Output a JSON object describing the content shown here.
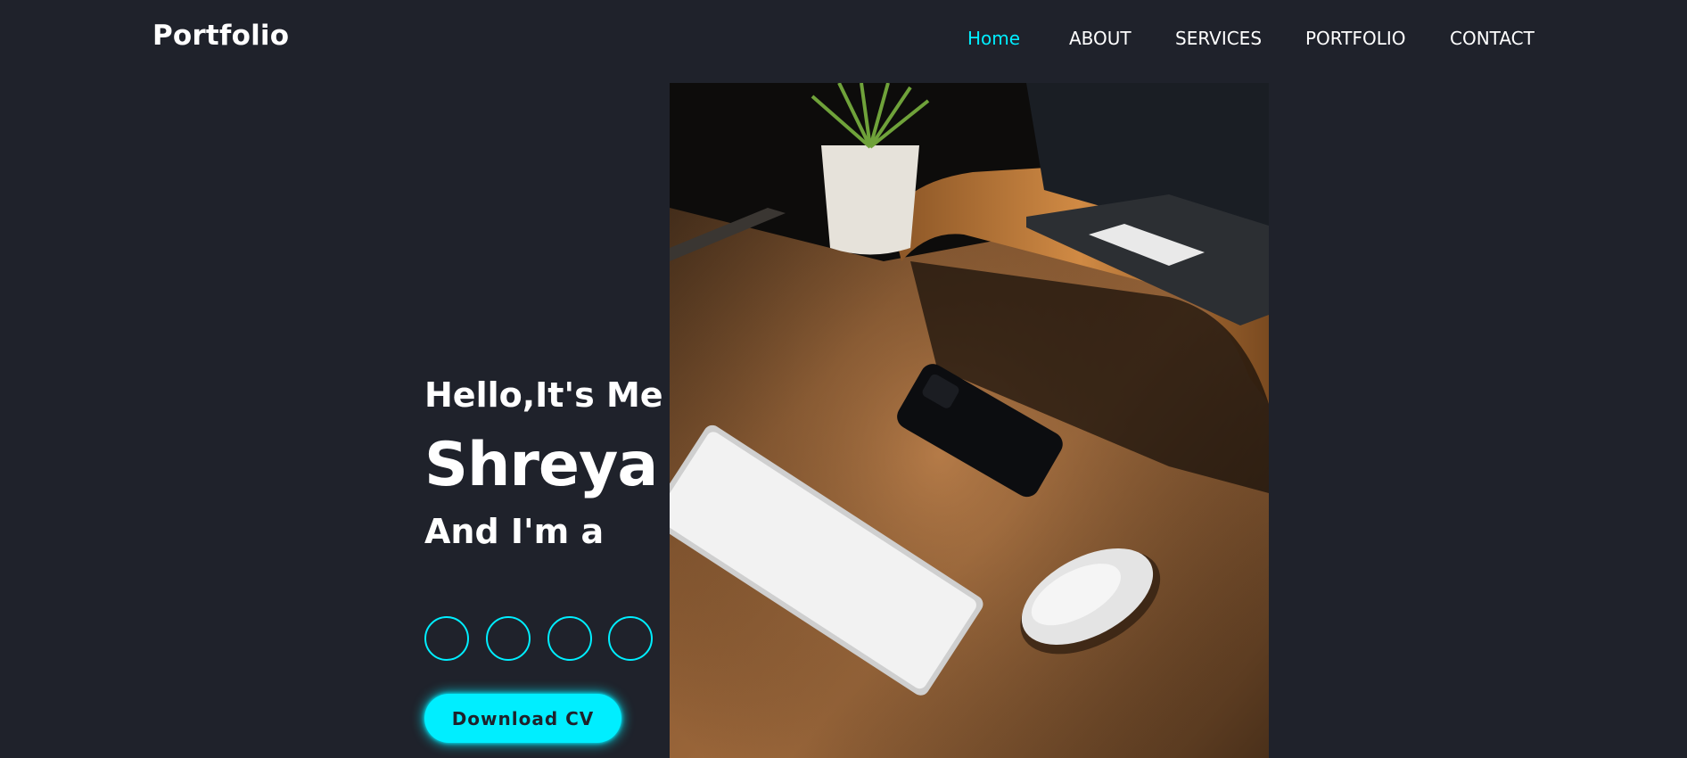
{
  "header": {
    "logo": "Portfolio",
    "nav": [
      {
        "label": "Home",
        "active": true
      },
      {
        "label": "ABOUT",
        "active": false
      },
      {
        "label": "SERVICES",
        "active": false
      },
      {
        "label": "PORTFOLIO",
        "active": false
      },
      {
        "label": "CONTACT",
        "active": false
      }
    ]
  },
  "hero": {
    "greeting": "Hello,It's Me",
    "name": "Shreya",
    "role_prefix": "And I'm a",
    "socials": [
      {
        "icon": "social-icon-1"
      },
      {
        "icon": "social-icon-2"
      },
      {
        "icon": "social-icon-3"
      },
      {
        "icon": "social-icon-4"
      }
    ],
    "cta_label": "Download CV",
    "image_alt": "Desk with keyboard, phone and mouse",
    "accent_color": "#00eeff",
    "background_color": "#1f222b"
  }
}
